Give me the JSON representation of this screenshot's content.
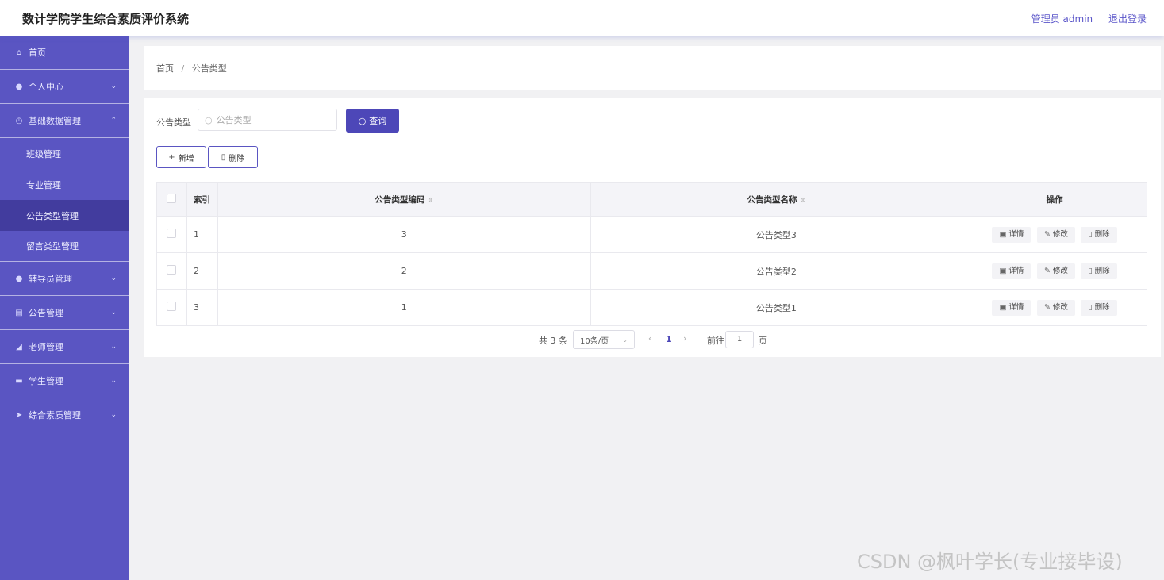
{
  "header": {
    "title": "数计学院学生综合素质评价系统",
    "user": "管理员 admin",
    "logout": "退出登录"
  },
  "sidebar": {
    "home": "首页",
    "personal": "个人中心",
    "basic_data": "基础数据管理",
    "sub_items": [
      "班级管理",
      "专业管理",
      "公告类型管理",
      "留言类型管理"
    ],
    "counselor": "辅导员管理",
    "notice": "公告管理",
    "teacher": "老师管理",
    "student": "学生管理",
    "quality": "综合素质管理"
  },
  "breadcrumb": {
    "home": "首页",
    "separator": "/",
    "current": "公告类型"
  },
  "search": {
    "label": "公告类型",
    "placeholder": "公告类型",
    "button": "查询"
  },
  "actions": {
    "add": "新增",
    "delete": "删除"
  },
  "table": {
    "headers": {
      "index": "索引",
      "code": "公告类型编码",
      "name": "公告类型名称",
      "ops": "操作"
    },
    "rows": [
      {
        "index": "1",
        "code": "3",
        "name": "公告类型3"
      },
      {
        "index": "2",
        "code": "2",
        "name": "公告类型2"
      },
      {
        "index": "3",
        "code": "1",
        "name": "公告类型1"
      }
    ],
    "row_ops": {
      "detail": "详情",
      "edit": "修改",
      "delete": "删除"
    }
  },
  "pagination": {
    "total": "共 3 条",
    "page_size": "10条/页",
    "current": "1",
    "goto": "前往",
    "goto_value": "1",
    "page_word": "页"
  },
  "watermark": "CSDN @枫叶学长(专业接毕设)"
}
